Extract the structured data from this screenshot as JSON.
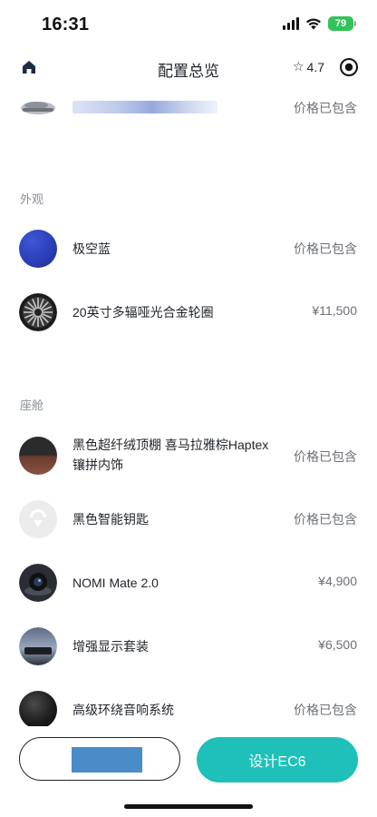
{
  "status_bar": {
    "time": "16:31",
    "battery": "79"
  },
  "nav": {
    "title": "配置总览",
    "rating": "4.7",
    "star": "☆"
  },
  "top_item": {
    "price": "价格已包含"
  },
  "sections": {
    "exterior": {
      "header": "外观",
      "items": [
        {
          "name": "极空蓝",
          "price": "价格已包含"
        },
        {
          "name": "20英寸多辐哑光合金轮圈",
          "price": "¥11,500"
        }
      ]
    },
    "cabin": {
      "header": "座舱",
      "items": [
        {
          "name": "黑色超纤绒顶棚 喜马拉雅棕Haptex镶拼内饰",
          "price": "价格已包含"
        },
        {
          "name": "黑色智能钥匙",
          "price": "价格已包含"
        },
        {
          "name": "NOMI Mate 2.0",
          "price": "¥4,900"
        },
        {
          "name": "增强显示套装",
          "price": "¥6,500"
        },
        {
          "name": "高级环绕音响系统",
          "price": "价格已包含"
        }
      ]
    }
  },
  "bottom": {
    "design_label": "设计EC6"
  },
  "colors": {
    "accent": "#1fc0b9",
    "blue_swatch": "#2a3fb8",
    "masked_button": "#4a8cc7"
  }
}
